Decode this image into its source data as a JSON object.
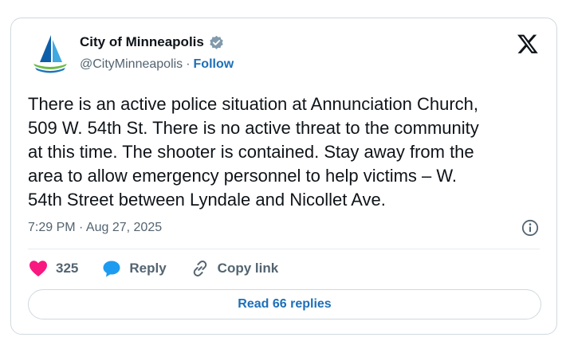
{
  "tweet": {
    "display_name": "City of Minneapolis",
    "handle": "@CityMinneapolis",
    "separator": "·",
    "follow_label": "Follow",
    "text": "There is an active police situation at Annunciation Church,\n509 W. 54th St. There is no active threat to the community\nat this time. The shooter is contained. Stay away from the\narea to allow emergency personnel to help victims – W.\n54th Street between Lyndale and Nicollet Ave.",
    "timestamp": "7:29 PM · Aug 27, 2025",
    "likes": "325",
    "reply_label": "Reply",
    "copy_link_label": "Copy link",
    "read_replies_label": "Read 66 replies"
  },
  "icons": {
    "avatar": "city-sailboat-logo",
    "verified": "verified-badge-icon",
    "platform": "x-logo-icon",
    "info": "info-icon",
    "like": "heart-icon",
    "reply": "speech-bubble-icon",
    "copy": "link-icon"
  },
  "colors": {
    "link_blue": "#1d6fb8",
    "heart": "#f91880",
    "reply_bubble": "#1d9bf0",
    "muted": "#536471",
    "border": "#cfd9de"
  }
}
